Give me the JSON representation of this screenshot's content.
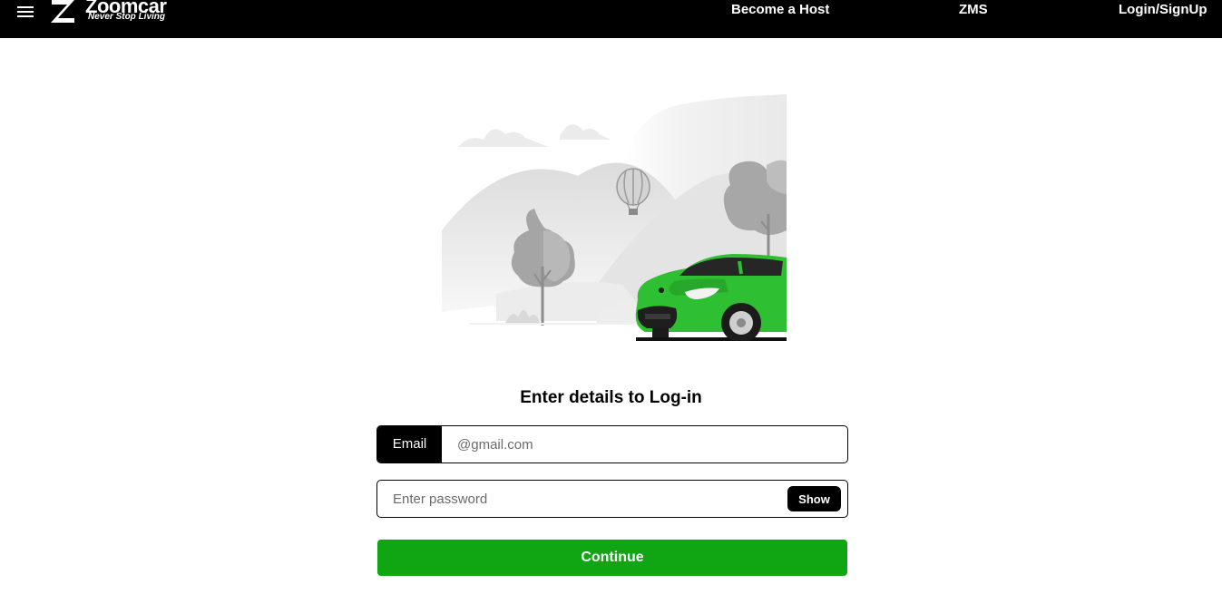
{
  "header": {
    "brand_name": "Zoomcar",
    "tagline": "Never Stop Living",
    "nav": {
      "become_host": "Become a Host",
      "zms": "ZMS",
      "login_signup": "Login/SignUp"
    }
  },
  "login": {
    "heading": "Enter details to Log-in",
    "email_label": "Email",
    "email_placeholder": "@gmail.com",
    "password_placeholder": "Enter password",
    "show_label": "Show",
    "continue_label": "Continue"
  },
  "colors": {
    "header_bg": "#000000",
    "accent_green": "#0fa513",
    "car_green": "#2fbf33"
  },
  "icons": [
    "hamburger-menu-icon",
    "zoomcar-logo-icon"
  ]
}
